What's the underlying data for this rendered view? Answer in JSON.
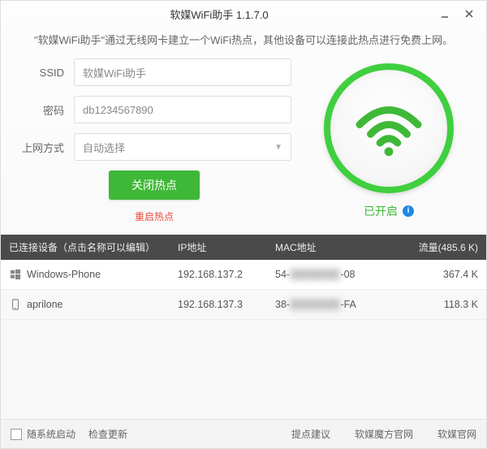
{
  "title": "软媒WiFi助手 1.1.7.0",
  "description": "\"软媒WiFi助手\"通过无线网卡建立一个WiFi热点，其他设备可以连接此热点进行免费上网。",
  "form": {
    "ssid_label": "SSID",
    "ssid_value": "软媒WiFi助手",
    "pwd_label": "密码",
    "pwd_value": "db1234567890",
    "mode_label": "上网方式",
    "mode_value": "自动选择",
    "close_btn": "关闭热点",
    "restart": "重启热点"
  },
  "status": {
    "label": "已开启"
  },
  "table": {
    "header_devices": "已连接设备（点击名称可以编辑）",
    "header_ip": "IP地址",
    "header_mac": "MAC地址",
    "header_traffic": "流量(485.6 K)",
    "rows": [
      {
        "name": "Windows-Phone",
        "ip": "192.168.137.2",
        "mac_pre": "54-",
        "mac_suf": "-08",
        "traffic": "367.4 K",
        "icon": "windows"
      },
      {
        "name": "aprilone",
        "ip": "192.168.137.3",
        "mac_pre": "38-",
        "mac_suf": "-FA",
        "traffic": "118.3 K",
        "icon": "phone"
      }
    ]
  },
  "footer": {
    "autostart": "随系统启动",
    "check_update": "检查更新",
    "suggestion": "提点建议",
    "mofang": "软媒魔方官网",
    "ruanmei": "软媒官网"
  }
}
